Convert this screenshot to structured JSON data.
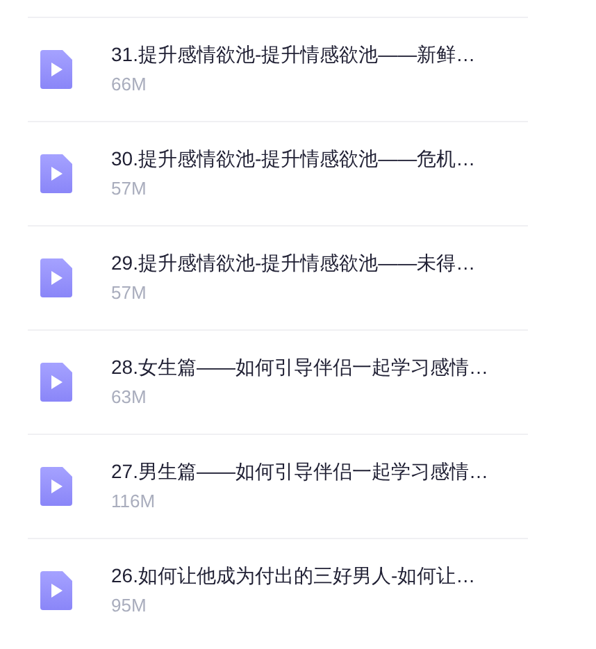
{
  "files": [
    {
      "name": "31.提升感情欲池-提升情感欲池——新鲜…",
      "size": "66M"
    },
    {
      "name": "30.提升感情欲池-提升情感欲池——危机…",
      "size": "57M"
    },
    {
      "name": "29.提升感情欲池-提升情感欲池——未得…",
      "size": "57M"
    },
    {
      "name": "28.女生篇——如何引导伴侣一起学习感情…",
      "size": "63M"
    },
    {
      "name": "27.男生篇——如何引导伴侣一起学习感情…",
      "size": "116M"
    },
    {
      "name": "26.如何让他成为付出的三好男人-如何让…",
      "size": "95M"
    }
  ]
}
